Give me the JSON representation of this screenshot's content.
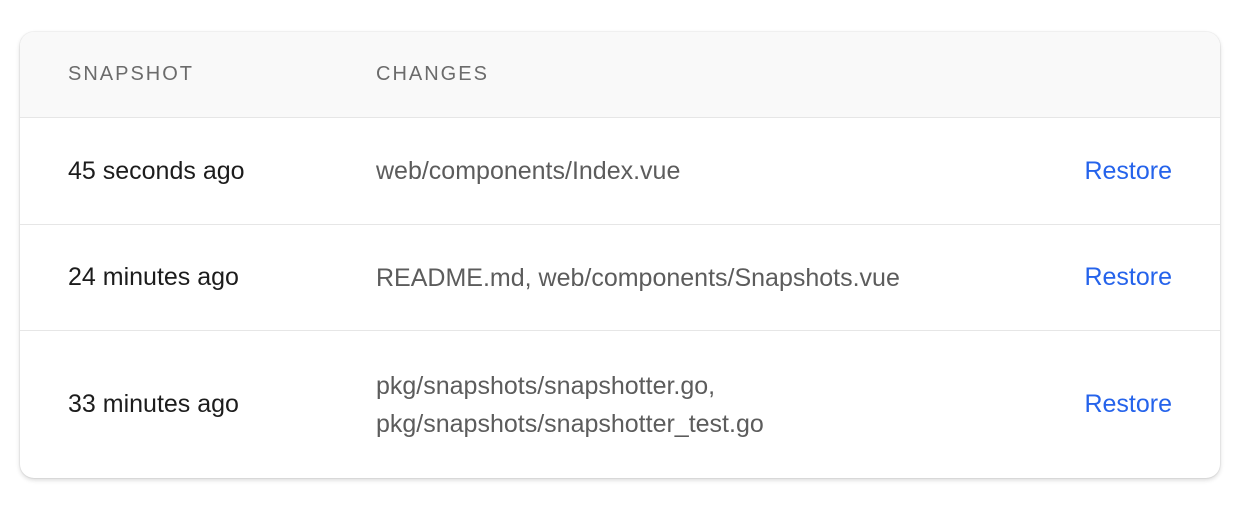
{
  "table": {
    "headers": {
      "snapshot": "SNAPSHOT",
      "changes": "CHANGES"
    },
    "rows": [
      {
        "time": "45 seconds ago",
        "changes": [
          "web/components/Index.vue"
        ],
        "action": "Restore"
      },
      {
        "time": "24 minutes ago",
        "changes": [
          "README.md, web/components/Snapshots.vue"
        ],
        "action": "Restore"
      },
      {
        "time": "33 minutes ago",
        "changes": [
          "pkg/snapshots/snapshotter.go,",
          "pkg/snapshots/snapshotter_test.go"
        ],
        "action": "Restore"
      }
    ]
  },
  "colors": {
    "accent": "#2563eb",
    "header_bg": "#f9f9f9",
    "border": "#e6e6e6"
  }
}
